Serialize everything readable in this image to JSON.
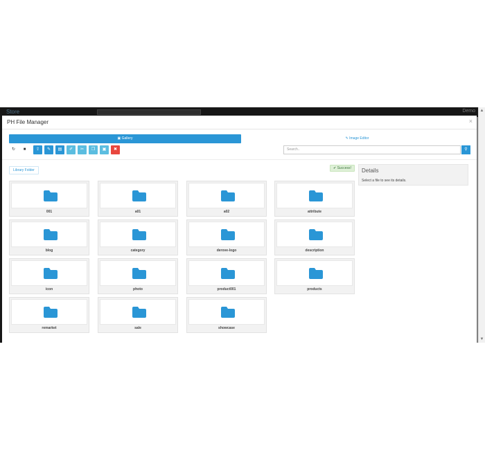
{
  "background": {
    "logo": "Store",
    "user": "Demo"
  },
  "modal": {
    "title": "PH File Manager",
    "close": "×",
    "tabs": {
      "gallery": "Gallery",
      "image_editor": "Image Editor"
    },
    "toolbar": {
      "buttons": [
        {
          "name": "refresh",
          "icon": "refresh-icon",
          "glyph": "↻"
        },
        {
          "name": "new-folder",
          "icon": "folder-icon",
          "glyph": "■"
        },
        {
          "name": "upload",
          "icon": "upload-icon",
          "glyph": "⇪"
        },
        {
          "name": "edit",
          "icon": "edit-icon",
          "glyph": "✎"
        },
        {
          "name": "file",
          "icon": "file-icon",
          "glyph": "▤"
        },
        {
          "name": "rename",
          "icon": "pencil-icon",
          "glyph": "✐"
        },
        {
          "name": "cut",
          "icon": "scissors-icon",
          "glyph": "✂"
        },
        {
          "name": "copy",
          "icon": "copy-icon",
          "glyph": "❐"
        },
        {
          "name": "paste",
          "icon": "paste-icon",
          "glyph": "▣"
        },
        {
          "name": "delete",
          "icon": "trash-icon",
          "glyph": "✖"
        }
      ],
      "search_placeholder": "Search..",
      "search_icon": "search-icon"
    },
    "library_folder": "Library Folder",
    "status": "Success!",
    "details": {
      "title": "Details",
      "text": "Select a file to see its details."
    },
    "folders": [
      "001",
      "a01",
      "a02",
      "attribute",
      "blog",
      "category",
      "derove-logo",
      "description",
      "icon",
      "photo",
      "product001",
      "products",
      "remarket",
      "sale",
      "showcase"
    ]
  },
  "colors": {
    "primary": "#2a96d6",
    "light": "#5bbde0",
    "danger": "#e8473e",
    "folder": "#2a96d6"
  }
}
